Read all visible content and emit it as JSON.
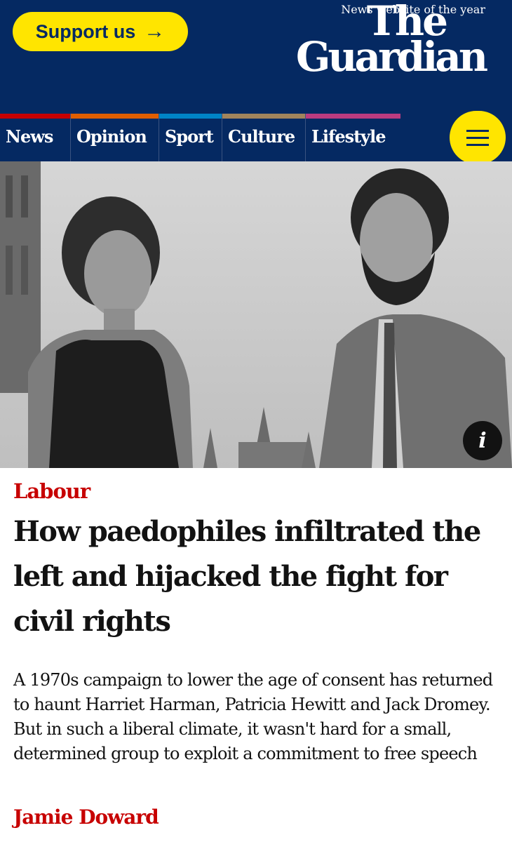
{
  "header": {
    "support_label": "Support us",
    "support_arrow": "→",
    "logo_line1": "The",
    "logo_line2": "Guardian",
    "tagline": "News website of the year"
  },
  "nav": {
    "items": [
      {
        "label": "News",
        "color": "#c70000"
      },
      {
        "label": "Opinion",
        "color": "#e05e00"
      },
      {
        "label": "Sport",
        "color": "#0084c6"
      },
      {
        "label": "Culture",
        "color": "#a1845c"
      },
      {
        "label": "Lifestyle",
        "color": "#bb3b80"
      }
    ],
    "menu_icon": "hamburger-icon"
  },
  "photo": {
    "description_icon": "info-icon",
    "info_glyph": "i"
  },
  "article": {
    "kicker": "Labour",
    "headline": "How paedophiles infiltrated the left and hijacked the fight for civil rights",
    "standfirst": "A 1970s campaign to lower the age of consent has returned to haunt Harriet Harman, Patricia Hewitt and Jack Dromey. But in such a liberal climate, it wasn't hard for a small, determined group to exploit a commitment to free speech",
    "byline": "Jamie Doward"
  },
  "colors": {
    "brand_blue": "#052962",
    "accent_yellow": "#ffe500",
    "news_red": "#c70000"
  }
}
